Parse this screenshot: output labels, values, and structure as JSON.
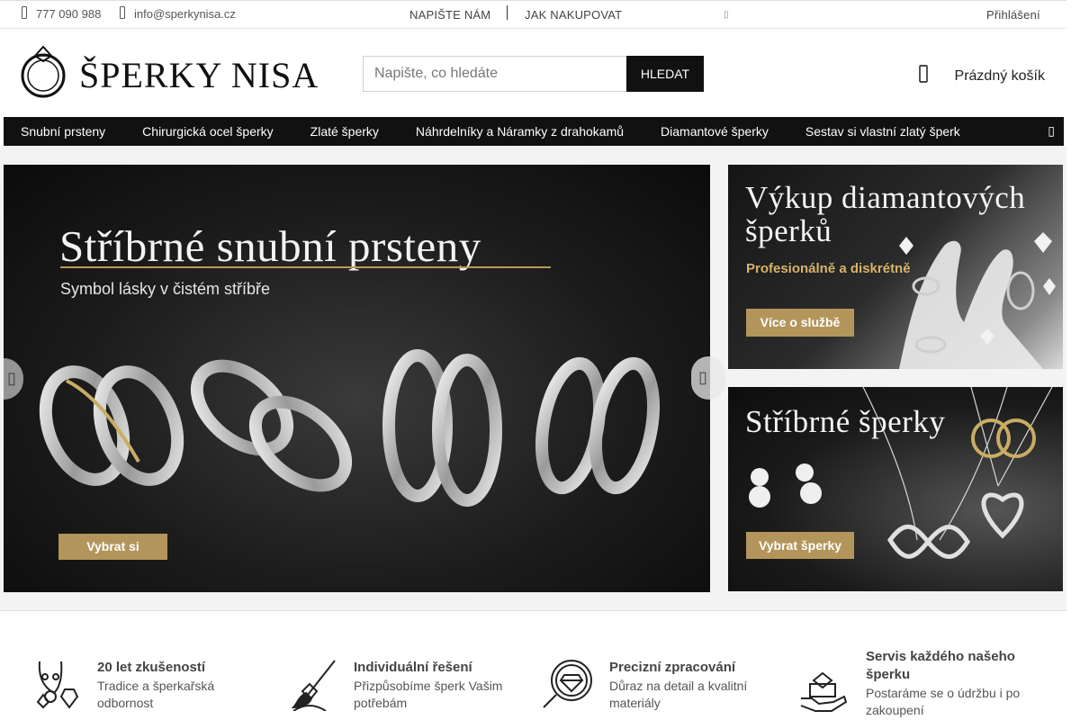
{
  "topbar": {
    "phone": "777 090 988",
    "email": "info@sperkynisa.cz",
    "links": [
      "NAPIŠTE NÁM",
      "JAK NAKUPOVAT"
    ],
    "login": "Přihlášení",
    "phone_icon": "phone-icon",
    "email_icon": "envelope-icon"
  },
  "header": {
    "logo_text": "ŠPERKY NISA",
    "search_placeholder": "Napište, co hledáte",
    "search_button": "HLEDAT",
    "cart_label": "Prázdný košík",
    "cart_icon": "cart-icon"
  },
  "nav": {
    "items": [
      "Snubní prsteny",
      "Chirurgická ocel šperky",
      "Zlaté šperky",
      "Náhrdelníky a Náramky z drahokamů",
      "Diamantové šperky",
      "Sestav si vlastní zlatý šperk"
    ]
  },
  "hero": {
    "title": "Stříbrné snubní prsteny",
    "subtitle": "Symbol lásky v čistém stříbře",
    "button": "Vybrat si"
  },
  "banners": [
    {
      "title_line1": "Výkup diamantových",
      "title_line2": "šperků",
      "subtitle": "Profesionálně a diskrétně",
      "button": "Více o službě"
    },
    {
      "title_line1": "Stříbrné šperky",
      "button": "Vybrat šperky"
    }
  ],
  "features": [
    {
      "title": "20 let zkušeností",
      "desc_line1": "Tradice a šperkařská",
      "desc_line2": "odbornost",
      "icon": "necklace-icon"
    },
    {
      "title": "Individuální řešení",
      "desc_line1": "Přizpůsobíme šperk Vašim",
      "desc_line2": "potřebám",
      "icon": "brush-diamond-icon"
    },
    {
      "title": "Precizní zpracování",
      "desc_line1": "Důraz na detail a kvalitní",
      "desc_line2": "materiály",
      "icon": "magnifier-diamond-icon"
    },
    {
      "title_line1": "Servis každého našeho",
      "title_line2": "šperku",
      "desc_line1": "Postaráme se o údržbu i po",
      "desc_line2": "zakoupení",
      "icon": "hand-ring-box-icon"
    }
  ],
  "colors": {
    "nav_bg": "#111111",
    "accent_gold": "#b3955b",
    "search_button_bg": "#111111"
  }
}
